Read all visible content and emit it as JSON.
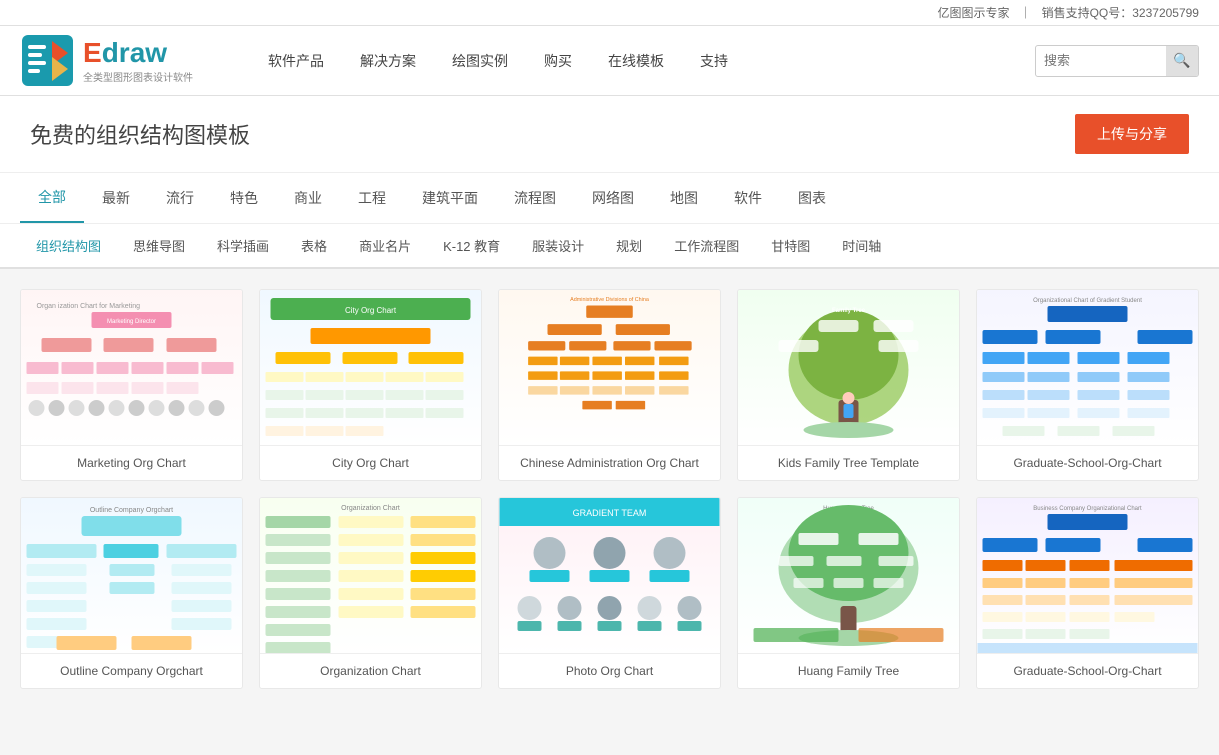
{
  "topbar": {
    "service": "亿图图示专家",
    "separator": "｜",
    "support": "销售支持QQ号：3237205799"
  },
  "header": {
    "logo_title_blue": "E",
    "logo_title_rest": "draw",
    "logo_subtitle": "全类型图形图表设计软件",
    "nav_items": [
      "软件产品",
      "解决方案",
      "绘图实例",
      "购买",
      "在线模板",
      "支持"
    ],
    "search_placeholder": "搜索"
  },
  "page": {
    "title": "免费的组织结构图模板",
    "upload_label": "上传与分享"
  },
  "filter_row1": {
    "tabs": [
      "全部",
      "最新",
      "流行",
      "特色",
      "商业",
      "工程",
      "建筑平面",
      "流程图",
      "网络图",
      "地图",
      "软件",
      "图表"
    ],
    "active": "全部"
  },
  "filter_row2": {
    "tabs": [
      "组织结构图",
      "思维导图",
      "科学插画",
      "表格",
      "商业名片",
      "K-12 教育",
      "服装设计",
      "规划",
      "工作流程图",
      "甘特图",
      "时间轴"
    ],
    "active": "组织结构图"
  },
  "cards": [
    {
      "id": "marketing",
      "label": "Marketing Org Chart",
      "thumb": "marketing"
    },
    {
      "id": "city",
      "label": "City Org Chart",
      "thumb": "city"
    },
    {
      "id": "chinese",
      "label": "Chinese Administration Org Chart",
      "thumb": "chinese"
    },
    {
      "id": "kids_tree",
      "label": "Kids Family Tree Template",
      "thumb": "kids_tree"
    },
    {
      "id": "gradient",
      "label": "Graduate-School-Org-Chart",
      "thumb": "gradient"
    },
    {
      "id": "outline",
      "label": "Outline Company Orgchart",
      "thumb": "outline"
    },
    {
      "id": "org",
      "label": "Organization Chart",
      "thumb": "org"
    },
    {
      "id": "photo",
      "label": "Photo Org Chart",
      "thumb": "photo"
    },
    {
      "id": "huang",
      "label": "Huang Family Tree",
      "thumb": "huang"
    },
    {
      "id": "grad_school",
      "label": "Graduate-School-Org-Chart",
      "thumb": "grad_school"
    }
  ],
  "icons": {
    "search": "🔍"
  }
}
